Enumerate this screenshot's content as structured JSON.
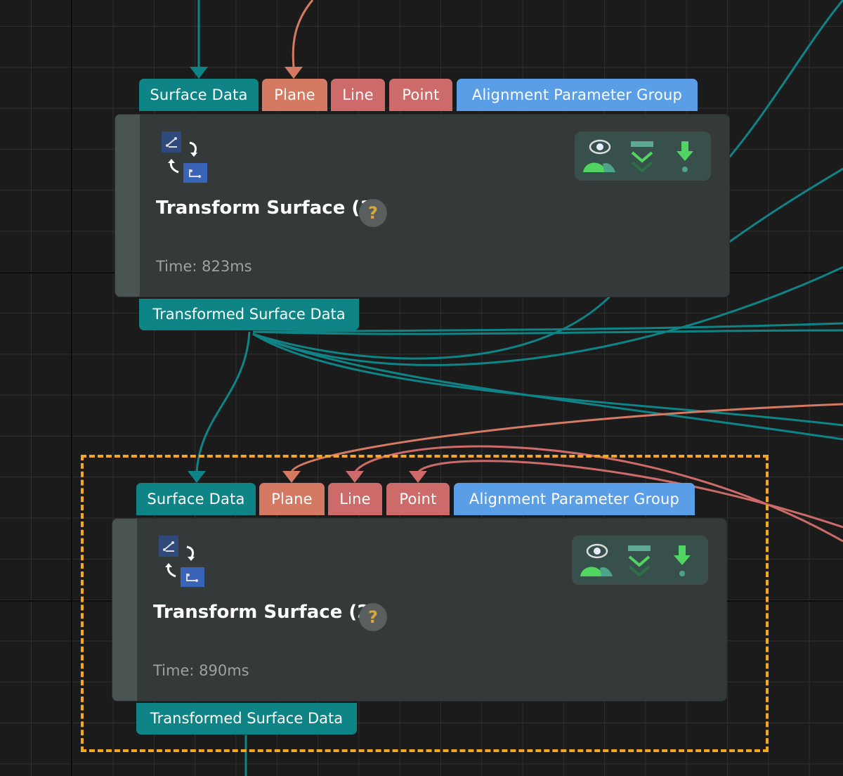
{
  "nodes": [
    {
      "title": "Transform Surface (1)",
      "help": "?",
      "time": "Time: 823ms",
      "inputs": [
        "Surface Data",
        "Plane",
        "Line",
        "Point",
        "Alignment Parameter Group"
      ],
      "output": "Transformed Surface Data"
    },
    {
      "title": "Transform Surface (2)",
      "help": "?",
      "time": "Time: 890ms",
      "inputs": [
        "Surface Data",
        "Plane",
        "Line",
        "Point",
        "Alignment Parameter Group"
      ],
      "output": "Transformed Surface Data"
    }
  ],
  "colors": {
    "surface": "#0e8486",
    "plane": "#d47a62",
    "line": "#cd6b6b",
    "point": "#cd6b6b",
    "alignment": "#5b9ee8",
    "selection": "#f5a623"
  }
}
